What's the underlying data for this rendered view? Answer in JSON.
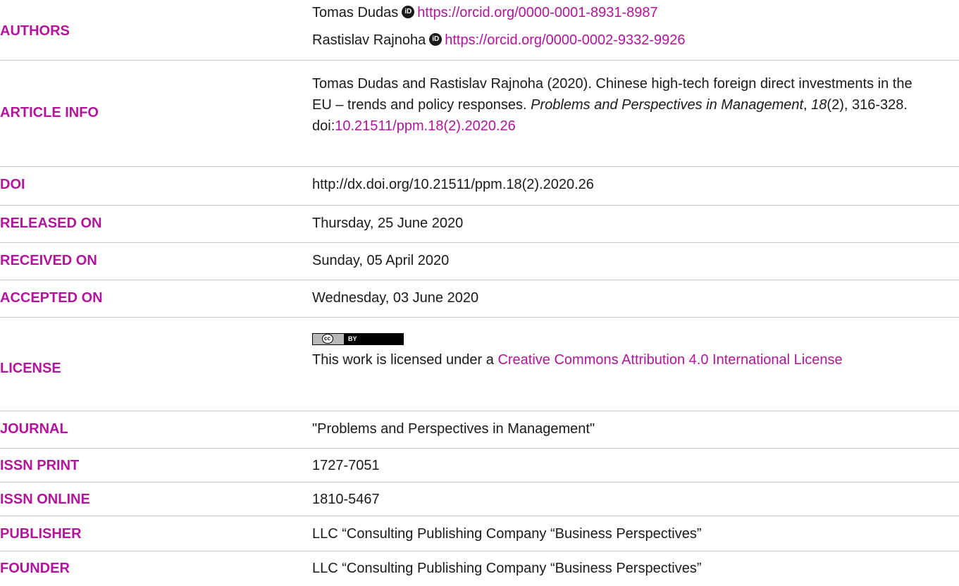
{
  "rows": {
    "authors": {
      "label": "AUTHORS",
      "a1_name": "Tomas Dudas",
      "a1_orcid": "https://orcid.org/0000-0001-8931-8987",
      "a2_name": "Rastislav Rajnoha",
      "a2_orcid": "https://orcid.org/0000-0002-9332-9926"
    },
    "article_info": {
      "label": "ARTICLE INFO",
      "authors_year": "Tomas Dudas and Rastislav Rajnoha (2020). Chinese high-tech foreign direct investments in the EU – trends and policy responses. ",
      "journal_italic": "Problems and Perspectives in Management",
      "sep1": ", ",
      "volume_italic": "18",
      "issue_pages": "(2), 316-328. doi:",
      "doi_link": "10.21511/ppm.18(2).2020.26"
    },
    "doi": {
      "label": "DOI",
      "value": "http://dx.doi.org/10.21511/ppm.18(2).2020.26"
    },
    "released": {
      "label": "RELEASED ON",
      "value": "Thursday, 25 June 2020"
    },
    "received": {
      "label": "RECEIVED ON",
      "value": "Sunday, 05 April 2020"
    },
    "accepted": {
      "label": "ACCEPTED ON",
      "value": "Wednesday, 03 June 2020"
    },
    "license": {
      "label": "LICENSE",
      "badge_cc": "cc",
      "badge_by": "BY",
      "text": "This work is licensed under a ",
      "link": "Creative Commons Attribution 4.0 International License"
    },
    "journal": {
      "label": "JOURNAL",
      "value": "\"Problems and Perspectives in Management\""
    },
    "issn_print": {
      "label": "ISSN PRINT",
      "value": "1727-7051"
    },
    "issn_online": {
      "label": "ISSN ONLINE",
      "value": "1810-5467"
    },
    "publisher": {
      "label": "PUBLISHER",
      "value": "LLC “Consulting Publishing Company “Business Perspectives”"
    },
    "founder": {
      "label": "FOUNDER",
      "value": "LLC “Consulting Publishing Company “Business Perspectives”"
    }
  },
  "colors": {
    "accent": "#b2149b",
    "separator": "#c8c8c8",
    "text": "#1a1a1a"
  }
}
